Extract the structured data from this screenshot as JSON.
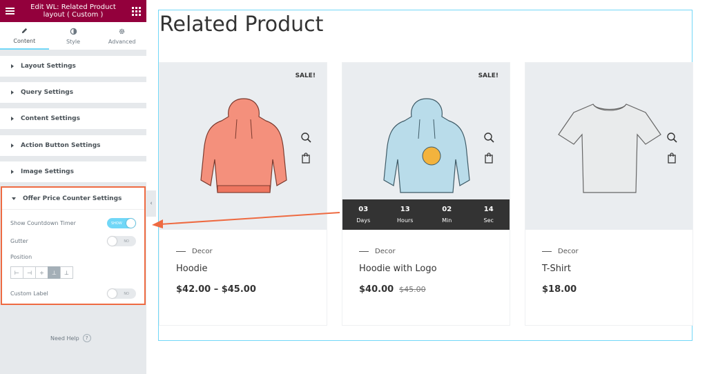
{
  "editor": {
    "title": "Edit WL: Related Product layout ( Custom )",
    "tabs": [
      {
        "label": "Content",
        "icon": "pencil-icon"
      },
      {
        "label": "Style",
        "icon": "contrast-icon"
      },
      {
        "label": "Advanced",
        "icon": "gear-icon"
      }
    ],
    "sections": [
      "Layout Settings",
      "Query Settings",
      "Content Settings",
      "Action Button Settings",
      "Image Settings"
    ],
    "offer": {
      "title": "Offer Price Counter Settings",
      "show_countdown_label": "Show Countdown Timer",
      "show_countdown_state": "SHOW",
      "gutter_label": "Gutter",
      "gutter_state": "NO",
      "position_label": "Position",
      "custom_label_label": "Custom Label",
      "custom_label_state": "NO"
    },
    "need_help": "Need Help"
  },
  "preview": {
    "heading": "Related Product",
    "products": [
      {
        "category": "Decor",
        "name": "Hoodie",
        "price": "$42.00 – $45.00",
        "sale": "SALE!"
      },
      {
        "category": "Decor",
        "name": "Hoodie with Logo",
        "price": "$40.00",
        "old_price": "$45.00",
        "sale": "SALE!"
      },
      {
        "category": "Decor",
        "name": "T-Shirt",
        "price": "$18.00"
      }
    ],
    "countdown": [
      {
        "value": "03",
        "label": "Days"
      },
      {
        "value": "13",
        "label": "Hours"
      },
      {
        "value": "02",
        "label": "Min"
      },
      {
        "value": "14",
        "label": "Sec"
      }
    ]
  },
  "colors": {
    "brand": "#93003c",
    "accent": "#71d7f7",
    "highlight": "#ee6a41"
  }
}
